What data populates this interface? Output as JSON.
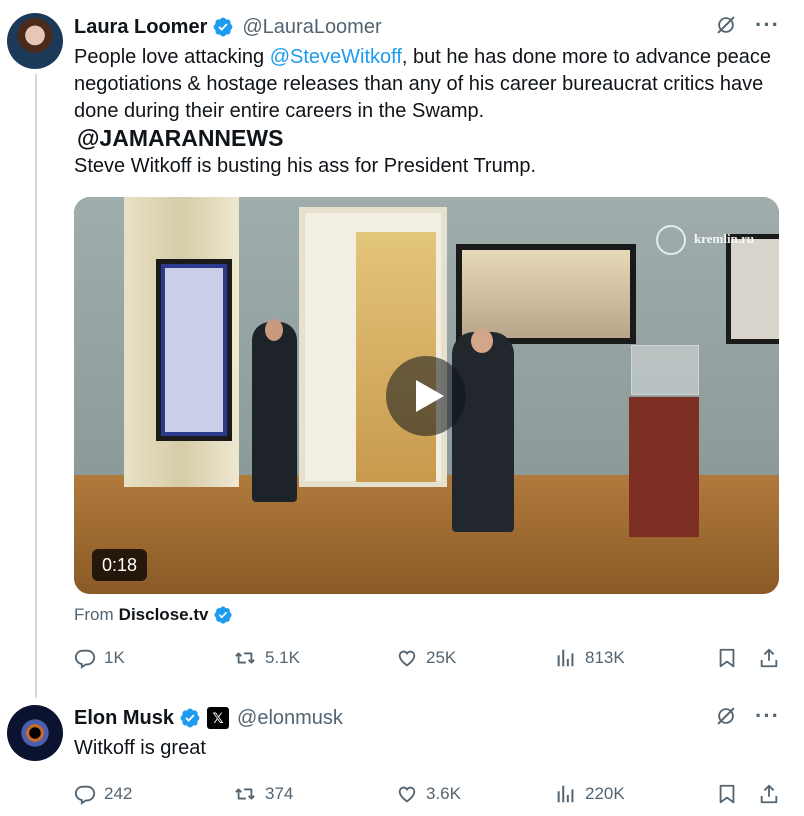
{
  "colors": {
    "accent": "#1d9bf0",
    "text": "#0f1419",
    "secondary": "#536471",
    "thread_line": "#cfd9de"
  },
  "tweet1": {
    "name": "Laura Loomer",
    "handle": "@LauraLoomer",
    "text_before_mention": "People love attacking ",
    "mention": "@SteveWitkoff",
    "text_after_mention": ", but he has done more to advance peace negotiations & hostage releases than any of his career bureaucrat critics have done during their entire careers in the Swamp.",
    "jamaran": "@JAMARANNEWS",
    "text_line3": "Steve Witkoff is busting his ass for President Trump.",
    "video": {
      "watermark": "kremlin.ru",
      "duration": "0:18",
      "play_icon": "play-icon"
    },
    "from_prefix": "From",
    "from_source": "Disclose.tv",
    "stats": {
      "replies": "1K",
      "reposts": "5.1K",
      "likes": "25K",
      "views": "813K"
    }
  },
  "tweet2": {
    "name": "Elon Musk",
    "affiliation_badge": "𝕏",
    "handle": "@elonmusk",
    "text": "Witkoff is great",
    "stats": {
      "replies": "242",
      "reposts": "374",
      "likes": "3.6K",
      "views": "220K"
    }
  }
}
